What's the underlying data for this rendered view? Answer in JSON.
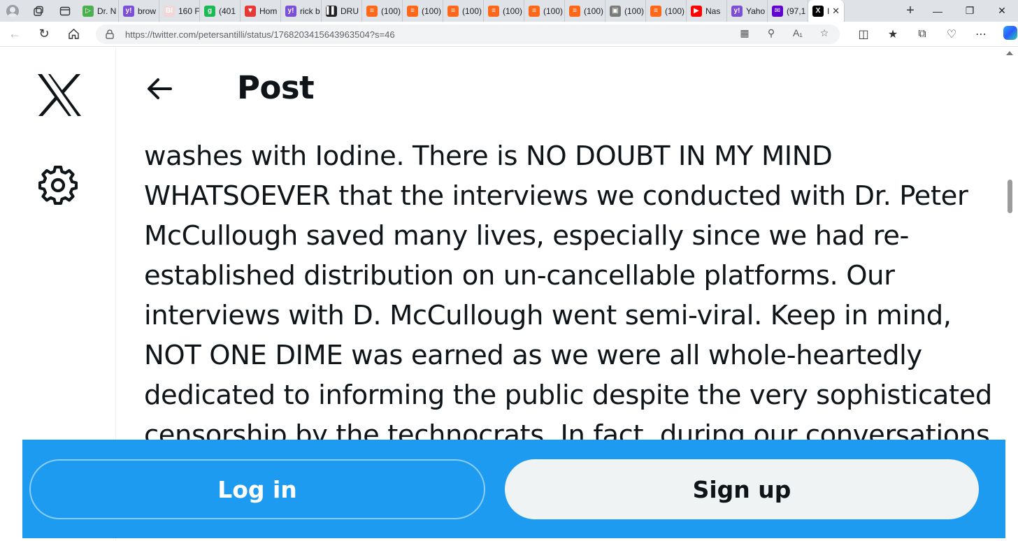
{
  "browser": {
    "tabs": [
      {
        "title": "Dr. N",
        "icon": "play-icon",
        "color": "#4caf50"
      },
      {
        "title": "brow",
        "icon": "yahoo-icon",
        "color": "#7b4fd6"
      },
      {
        "title": "160 F",
        "icon": "bi-icon",
        "color": "#f3d6d6"
      },
      {
        "title": "(401",
        "icon": "g-icon",
        "color": "#1db954"
      },
      {
        "title": "Hom",
        "icon": "bookmark-icon",
        "color": "#e53935"
      },
      {
        "title": "rick b",
        "icon": "yahoo-icon",
        "color": "#7b4fd6"
      },
      {
        "title": "DRU",
        "icon": "drudge-icon",
        "color": "#222222"
      },
      {
        "title": "(100)",
        "icon": "substack-icon",
        "color": "#ff6719"
      },
      {
        "title": "(100)",
        "icon": "substack-icon",
        "color": "#ff6719"
      },
      {
        "title": "(100)",
        "icon": "substack-icon",
        "color": "#ff6719"
      },
      {
        "title": "(100)",
        "icon": "substack-icon",
        "color": "#ff6719"
      },
      {
        "title": "(100)",
        "icon": "substack-icon",
        "color": "#ff6719"
      },
      {
        "title": "(100)",
        "icon": "substack-icon",
        "color": "#ff6719"
      },
      {
        "title": "(100)",
        "icon": "image-icon",
        "color": "#7a7a7a"
      },
      {
        "title": "(100)",
        "icon": "substack-icon",
        "color": "#ff6719"
      },
      {
        "title": "Nas",
        "icon": "youtube-icon",
        "color": "#ff0000"
      },
      {
        "title": "Yaho",
        "icon": "yahoo-icon",
        "color": "#7b4fd6"
      },
      {
        "title": "(97,1",
        "icon": "mail-icon",
        "color": "#6001d2"
      }
    ],
    "active_tab": {
      "title": "I",
      "icon": "x-icon",
      "color": "#000000"
    },
    "url": "https://twitter.com/petersantilli/status/1768203415643963504?s=46"
  },
  "post": {
    "header_title": "Post",
    "text_lines": [
      "washes with Iodine.   There is NO DOUBT IN MY MIND",
      "WHATSOEVER that the interviews we conducted with Dr. Peter",
      "McCullough saved many lives, especially since we had re-",
      "established distribution on un-cancellable  platforms.  Our",
      "interviews with D. McCullough went semi-viral.  Keep in mind,",
      "NOT ONE DIME was earned as we were all whole-heartedly",
      "dedicated to informing the public despite the very sophisticated",
      "censorship by the technocrats.  In fact, during our conversations"
    ]
  },
  "bottom_bar": {
    "login_label": "Log in",
    "signup_label": "Sign up",
    "color": "#1d9bf0"
  }
}
